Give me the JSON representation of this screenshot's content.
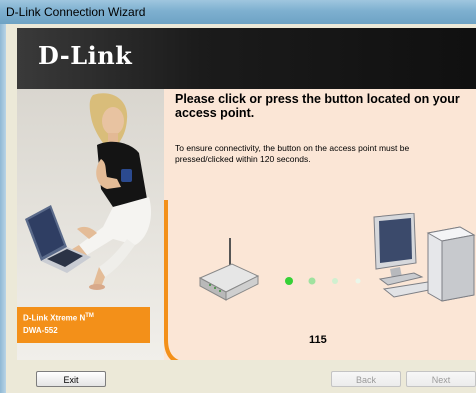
{
  "window": {
    "title": "D-Link Connection Wizard"
  },
  "brand": {
    "logo_text": "D-Link",
    "accent_color": "#f39019",
    "banner_color": "#1b1b1b",
    "content_bg": "#fbe6d6"
  },
  "product": {
    "name": "D-Link Xtreme N",
    "name_suffix": "TM",
    "model": "DWA-552"
  },
  "main": {
    "heading": "Please click or press the button located on your access point.",
    "instruction": "To ensure connectivity, the button on the access point must be pressed/clicked within 120 seconds.",
    "countdown": "115",
    "progress_dots": 4,
    "progress_dots_active": 1
  },
  "buttons": {
    "exit": "Exit",
    "back": "Back",
    "next": "Next"
  }
}
